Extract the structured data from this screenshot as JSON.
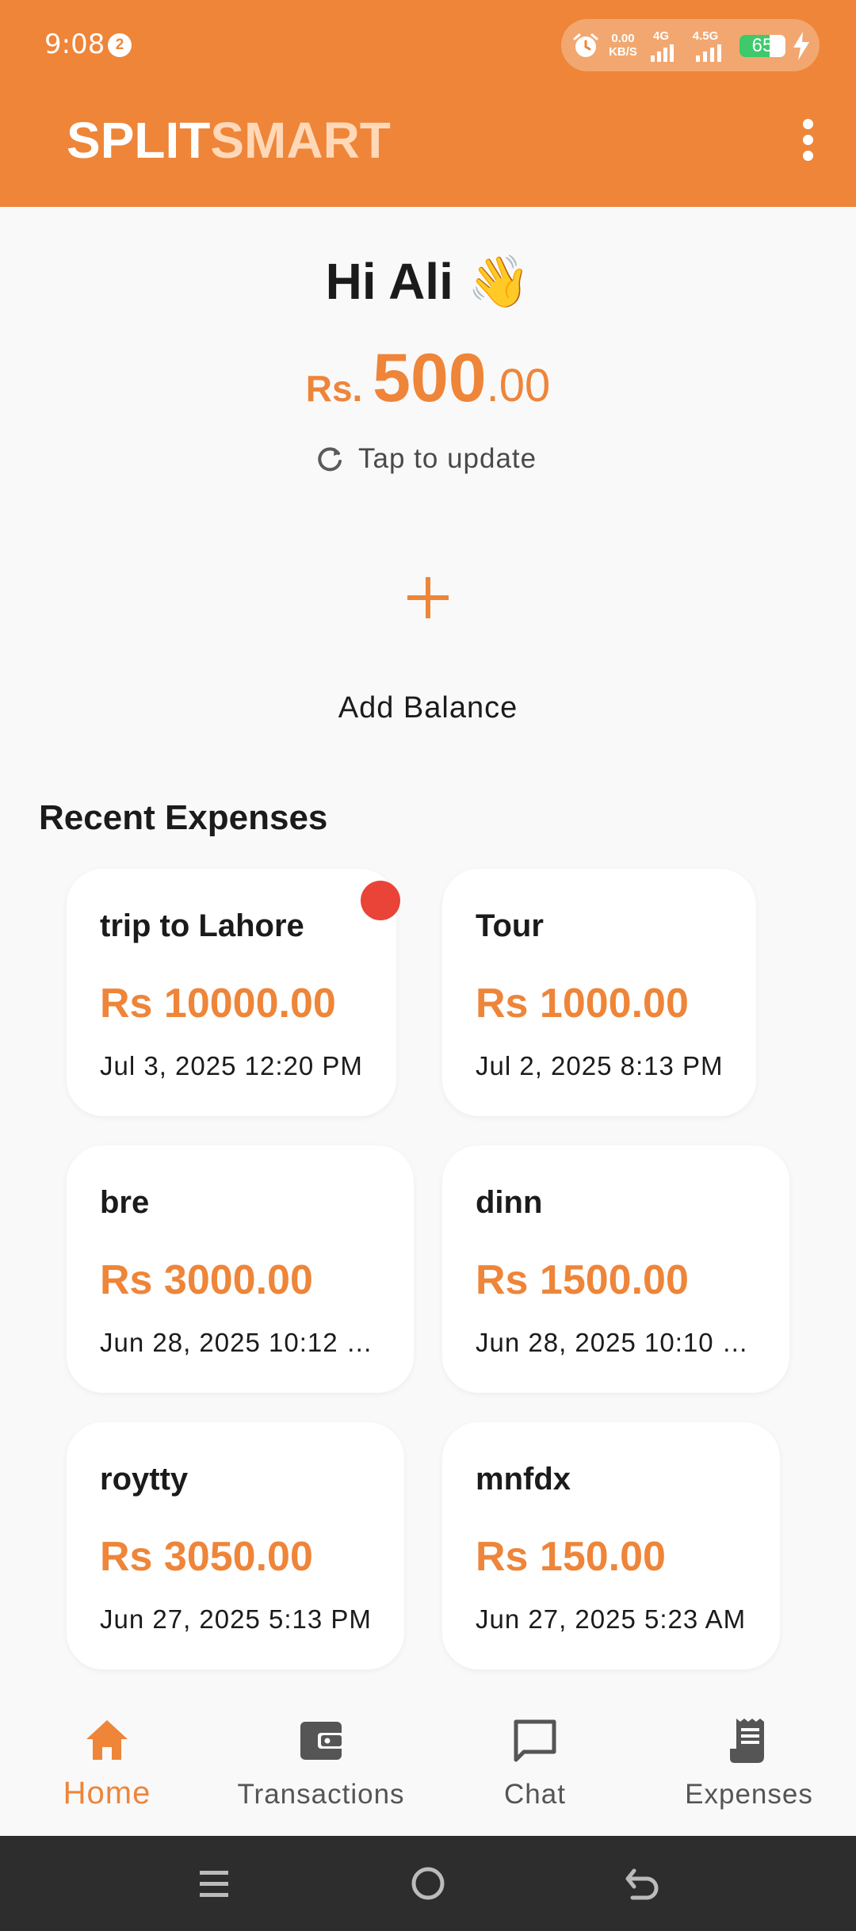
{
  "status_bar": {
    "time": "9:08",
    "notification_count": "2",
    "net_speed_value": "0.00",
    "net_speed_unit": "KB/S",
    "network_1": "4G",
    "network_2": "4.5G",
    "battery_level": "65",
    "battery_fraction": 0.65
  },
  "header": {
    "brand_part1": "SPLIT",
    "brand_part2": "SMART"
  },
  "home": {
    "greeting": "Hi Ali 👋",
    "balance_currency": "Rs. ",
    "balance_integer": "500",
    "balance_decimal": ".00",
    "tap_to_update": "Tap to update",
    "add_balance": "Add Balance"
  },
  "recent_expenses": {
    "title": "Recent Expenses",
    "items": [
      {
        "name": "trip to Lahore",
        "amount": "Rs 10000.00",
        "date": "Jul 3, 2025 12:20 PM",
        "unread": true
      },
      {
        "name": "Tour",
        "amount": "Rs 1000.00",
        "date": "Jul 2, 2025 8:13 PM",
        "unread": false
      },
      {
        "name": "bre",
        "amount": "Rs 3000.00",
        "date": "Jun 28, 2025 10:12 …",
        "unread": false
      },
      {
        "name": "dinn",
        "amount": "Rs 1500.00",
        "date": "Jun 28, 2025 10:10 …",
        "unread": false
      },
      {
        "name": "roytty",
        "amount": "Rs 3050.00",
        "date": "Jun 27, 2025 5:13 PM",
        "unread": false
      },
      {
        "name": "mnfdx",
        "amount": "Rs 150.00",
        "date": "Jun 27, 2025 5:23 AM",
        "unread": false
      }
    ]
  },
  "bottom_nav": {
    "items": [
      {
        "label": "Home",
        "icon": "home-icon",
        "active": true
      },
      {
        "label": "Transactions",
        "icon": "wallet-icon",
        "active": false
      },
      {
        "label": "Chat",
        "icon": "chat-icon",
        "active": false
      },
      {
        "label": "Expenses",
        "icon": "receipt-icon",
        "active": false
      }
    ]
  },
  "colors": {
    "accent": "#ee8539",
    "brand_secondary": "#ffd8b8",
    "unread_dot": "#ea4338",
    "battery_green": "#3ec96a"
  }
}
